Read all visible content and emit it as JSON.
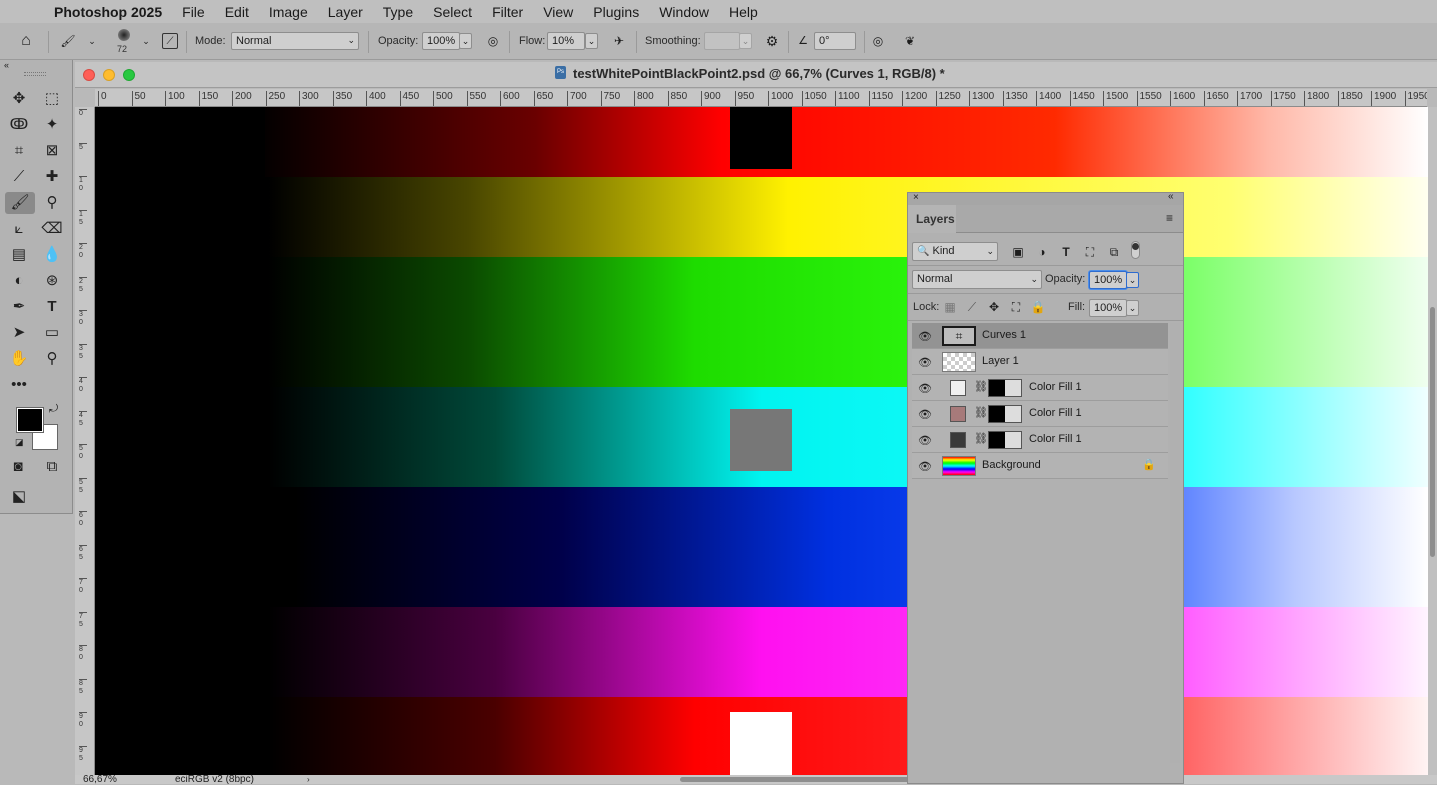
{
  "menubar": {
    "app_name": "Photoshop 2025",
    "items": [
      "File",
      "Edit",
      "Image",
      "Layer",
      "Type",
      "Select",
      "Filter",
      "View",
      "Plugins",
      "Window",
      "Help"
    ]
  },
  "options": {
    "brush_size": "72",
    "mode_label": "Mode:",
    "mode_value": "Normal",
    "opacity_label": "Opacity:",
    "opacity_value": "100%",
    "flow_label": "Flow:",
    "flow_value": "10%",
    "smoothing_label": "Smoothing:",
    "smoothing_value": "",
    "angle_value": "0°"
  },
  "document": {
    "title": "testWhitePointBlackPoint2.psd @ 66,7% (Curves 1, RGB/8) *",
    "ruler_h": [
      "0",
      "50",
      "100",
      "150",
      "200",
      "250",
      "300",
      "350",
      "400",
      "450",
      "500",
      "550",
      "600",
      "650",
      "700",
      "750",
      "800",
      "850",
      "900",
      "950",
      "1000",
      "1050",
      "1100",
      "1150",
      "1200",
      "1250",
      "1300",
      "1350",
      "1400",
      "1450",
      "1500",
      "1550",
      "1600",
      "1650",
      "1700",
      "1750",
      "1800",
      "1850",
      "1900",
      "1950"
    ],
    "ruler_v": [
      "0",
      "5",
      "1 0",
      "1 5",
      "2 0",
      "2 5",
      "3 0",
      "3 5",
      "4 0",
      "4 5",
      "5 0",
      "5 5",
      "6 0",
      "6 5",
      "7 0",
      "7 5",
      "8 0",
      "8 5",
      "9 0",
      "9 5"
    ],
    "zoom": "66,67%",
    "profile": "eciRGB v2 (8bpc)"
  },
  "layers_panel": {
    "tab": "Layers",
    "filter_kind": "Kind",
    "blend_mode": "Normal",
    "opacity_label": "Opacity:",
    "opacity_value": "100%",
    "lock_label": "Lock:",
    "fill_label": "Fill:",
    "fill_value": "100%",
    "layers": [
      {
        "name": "Curves 1"
      },
      {
        "name": "Layer 1"
      },
      {
        "name": "Color Fill 1",
        "color": "#f0f0f0"
      },
      {
        "name": "Color Fill 1",
        "color": "#a77a7a"
      },
      {
        "name": "Color Fill 1",
        "color": "#3a3a3a"
      },
      {
        "name": "Background"
      }
    ]
  },
  "colors": {
    "foreground": "#000000",
    "background": "#ffffff",
    "selected_layer": "#939393"
  }
}
